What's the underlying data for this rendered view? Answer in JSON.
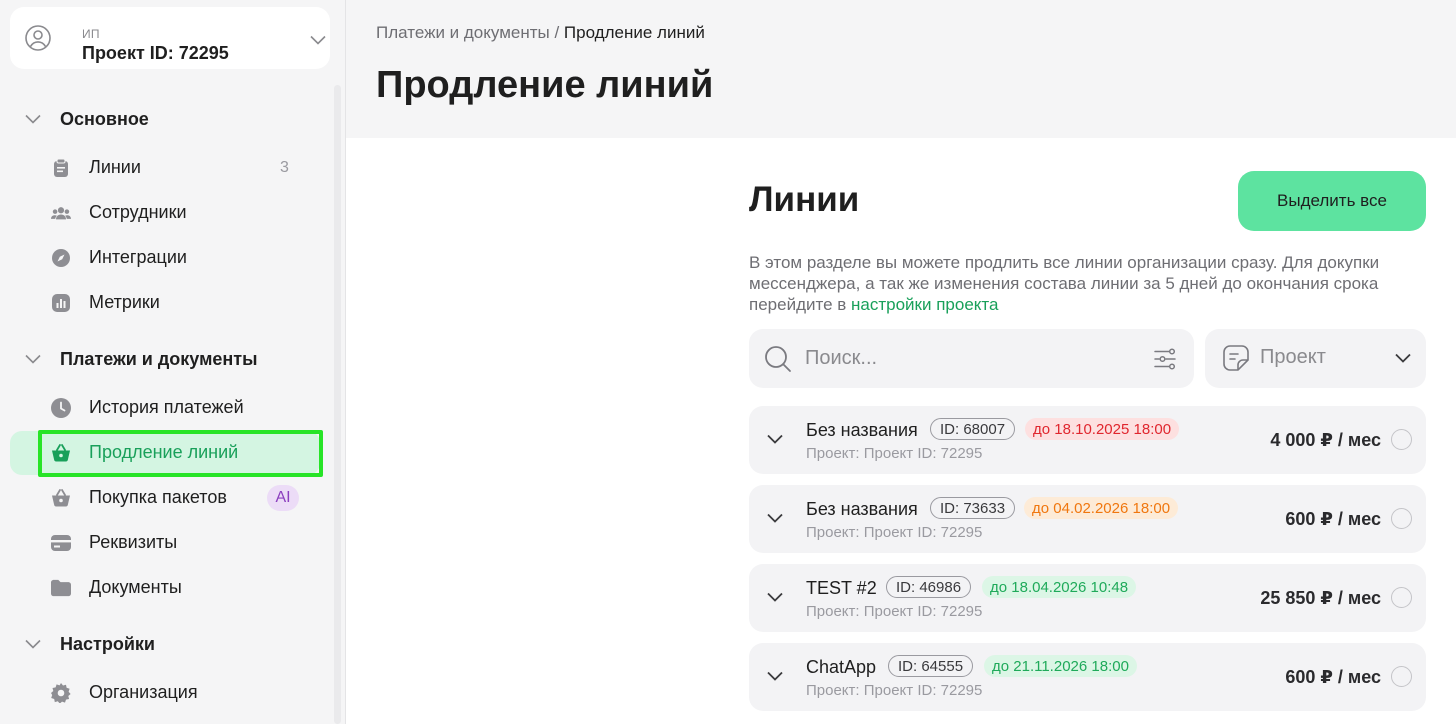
{
  "project": {
    "type_label": "ИП",
    "name": "Проект ID: 72295"
  },
  "sidebar": {
    "sections": [
      {
        "title": "Основное",
        "items": [
          {
            "label": "Линии",
            "icon": "clipboard-icon",
            "count": "3"
          },
          {
            "label": "Сотрудники",
            "icon": "team-icon"
          },
          {
            "label": "Интеграции",
            "icon": "compass-icon"
          },
          {
            "label": "Метрики",
            "icon": "chart-icon"
          }
        ]
      },
      {
        "title": "Платежи и документы",
        "items": [
          {
            "label": "История платежей",
            "icon": "clock-icon"
          },
          {
            "label": "Продление линий",
            "icon": "basket-icon",
            "active": true
          },
          {
            "label": "Покупка пакетов",
            "icon": "basket-icon",
            "badge": "AI"
          },
          {
            "label": "Реквизиты",
            "icon": "card-icon"
          },
          {
            "label": "Документы",
            "icon": "folder-icon"
          }
        ]
      },
      {
        "title": "Настройки",
        "items": [
          {
            "label": "Организация",
            "icon": "gear-icon"
          }
        ]
      }
    ]
  },
  "header": {
    "breadcrumb_parent": "Платежи и документы",
    "breadcrumb_separator": " / ",
    "breadcrumb_current": "Продление линий",
    "title": "Продление линий"
  },
  "content": {
    "section_title": "Линии",
    "select_all_label": "Выделить все",
    "description_text": "В этом разделе вы можете продлить все линии организации сразу. Для докупки мессенджера, а так же изменения состава линии за 5 дней до окончания срока перейдите в ",
    "description_link": "настройки проекта",
    "search_placeholder": "Поиск...",
    "project_filter_label": "Проект"
  },
  "lines": [
    {
      "name": "Без названия",
      "id": "ID: 68007",
      "date": "до 18.10.2025 18:00",
      "date_status": "red",
      "project": "Проект: Проект ID: 72295",
      "price": "4 000 ₽ / мес"
    },
    {
      "name": "Без названия",
      "id": "ID: 73633",
      "date": "до 04.02.2026 18:00",
      "date_status": "orange",
      "project": "Проект: Проект ID: 72295",
      "price": "600 ₽ / мес"
    },
    {
      "name": "TEST #2",
      "id": "ID: 46986",
      "date": "до 18.04.2026 10:48",
      "date_status": "green",
      "project": "Проект: Проект ID: 72295",
      "price": "25 850 ₽ / мес"
    },
    {
      "name": "ChatApp",
      "id": "ID: 64555",
      "date": "до 21.11.2026 18:00",
      "date_status": "green",
      "project": "Проект: Проект ID: 72295",
      "price": "600 ₽ / мес"
    }
  ],
  "colors": {
    "accent_green": "#5de3a0",
    "active_green_text": "#19a05a",
    "date_red": "#e0262e",
    "date_orange": "#f0770f",
    "date_green": "#1faa5a"
  }
}
